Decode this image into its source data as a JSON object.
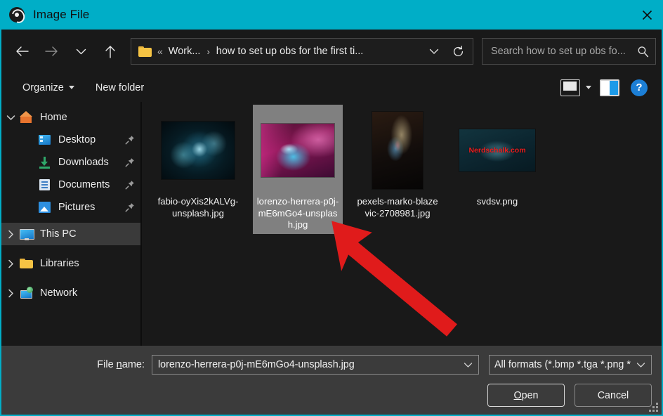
{
  "window": {
    "title": "Image File",
    "app_icon": "obs-logo-icon",
    "close_label": "×",
    "accent_color": "#00aec7",
    "background_color": "#191919",
    "panel_color": "#3b3b3b"
  },
  "nav": {
    "back": "back-arrow",
    "forward": "forward-arrow",
    "recent": "chevron-down",
    "up": "up-arrow",
    "refresh": "refresh-icon",
    "dropdown": "chevron-down-icon"
  },
  "address": {
    "folder_icon": "folder-icon",
    "overflow": "«",
    "crumb1": "Work...",
    "separator": "›",
    "crumb_last": "how to set up obs for the first ti..."
  },
  "search": {
    "placeholder": "Search how to set up obs fo...",
    "value": "",
    "icon": "search-icon"
  },
  "command_bar": {
    "organize": "Organize",
    "new_folder": "New folder",
    "view_options_icon": "view-options-icon",
    "preview_pane_icon": "preview-pane-icon",
    "help_label": "?"
  },
  "sidebar": {
    "items": [
      {
        "label": "Home",
        "icon": "home-icon",
        "level": 1,
        "chevron": "expanded",
        "pinned": false,
        "hovered": false
      },
      {
        "label": "Desktop",
        "icon": "desktop-icon",
        "level": 2,
        "chevron": "none",
        "pinned": true,
        "hovered": false
      },
      {
        "label": "Downloads",
        "icon": "downloads-icon",
        "level": 2,
        "chevron": "none",
        "pinned": true,
        "hovered": false
      },
      {
        "label": "Documents",
        "icon": "documents-icon",
        "level": 2,
        "chevron": "none",
        "pinned": true,
        "hovered": false
      },
      {
        "label": "Pictures",
        "icon": "pictures-icon",
        "level": 2,
        "chevron": "none",
        "pinned": true,
        "hovered": false
      },
      {
        "label": "This PC",
        "icon": "this-pc-icon",
        "level": 1,
        "chevron": "collapsed",
        "pinned": false,
        "hovered": true
      },
      {
        "label": "Libraries",
        "icon": "libraries-icon",
        "level": 1,
        "chevron": "collapsed",
        "pinned": false,
        "hovered": false
      },
      {
        "label": "Network",
        "icon": "network-icon",
        "level": 1,
        "chevron": "collapsed",
        "pinned": false,
        "hovered": false
      }
    ]
  },
  "files": [
    {
      "name": "fabio-oyXis2kALVg-unsplash.jpg",
      "art": "art1",
      "selected": false,
      "watermark": ""
    },
    {
      "name": "lorenzo-herrera-p0j-mE6mGo4-unsplash.jpg",
      "art": "art2",
      "selected": true,
      "watermark": ""
    },
    {
      "name": "pexels-marko-blazevic-2708981.jpg",
      "art": "art3",
      "selected": false,
      "watermark": ""
    },
    {
      "name": "svdsv.png",
      "art": "art4",
      "selected": false,
      "watermark": "Nerdschalk.com"
    }
  ],
  "annotation": {
    "type": "red-arrow",
    "color": "#e01b1b",
    "points_to": "lorenzo-herrera-p0j-mE6mGo4-unsplash.jpg"
  },
  "footer": {
    "filename_label_pre": "File ",
    "filename_label_accel": "n",
    "filename_label_post": "ame:",
    "filename_value": "lorenzo-herrera-p0j-mE6mGo4-unsplash.jpg",
    "filetype_value": "All formats (*.bmp *.tga *.png *.",
    "open_accel": "O",
    "open_rest": "pen",
    "cancel_label": "Cancel"
  }
}
